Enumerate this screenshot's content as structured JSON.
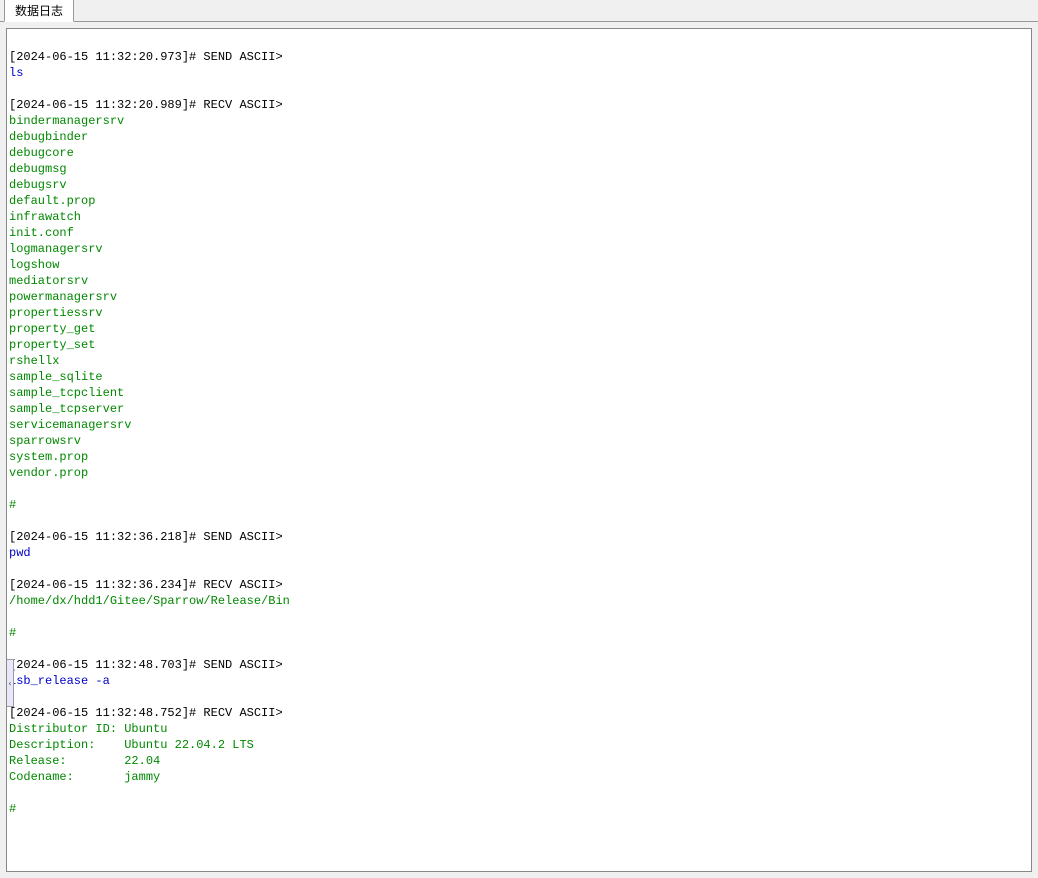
{
  "tab": {
    "label": "数据日志"
  },
  "handle": {
    "glyph": "‹"
  },
  "log": [
    {
      "type": "blank"
    },
    {
      "type": "header",
      "text": "[2024-06-15 11:32:20.973]# SEND ASCII>"
    },
    {
      "type": "cmd",
      "text": "ls"
    },
    {
      "type": "blank"
    },
    {
      "type": "header",
      "text": "[2024-06-15 11:32:20.989]# RECV ASCII>"
    },
    {
      "type": "recv",
      "text": "bindermanagersrv"
    },
    {
      "type": "recv",
      "text": "debugbinder"
    },
    {
      "type": "recv",
      "text": "debugcore"
    },
    {
      "type": "recv",
      "text": "debugmsg"
    },
    {
      "type": "recv",
      "text": "debugsrv"
    },
    {
      "type": "recv",
      "text": "default.prop"
    },
    {
      "type": "recv",
      "text": "infrawatch"
    },
    {
      "type": "recv",
      "text": "init.conf"
    },
    {
      "type": "recv",
      "text": "logmanagersrv"
    },
    {
      "type": "recv",
      "text": "logshow"
    },
    {
      "type": "recv",
      "text": "mediatorsrv"
    },
    {
      "type": "recv",
      "text": "powermanagersrv"
    },
    {
      "type": "recv",
      "text": "propertiessrv"
    },
    {
      "type": "recv",
      "text": "property_get"
    },
    {
      "type": "recv",
      "text": "property_set"
    },
    {
      "type": "recv",
      "text": "rshellx"
    },
    {
      "type": "recv",
      "text": "sample_sqlite"
    },
    {
      "type": "recv",
      "text": "sample_tcpclient"
    },
    {
      "type": "recv",
      "text": "sample_tcpserver"
    },
    {
      "type": "recv",
      "text": "servicemanagersrv"
    },
    {
      "type": "recv",
      "text": "sparrowsrv"
    },
    {
      "type": "recv",
      "text": "system.prop"
    },
    {
      "type": "recv",
      "text": "vendor.prop"
    },
    {
      "type": "blank"
    },
    {
      "type": "recv",
      "text": "# "
    },
    {
      "type": "blank"
    },
    {
      "type": "header",
      "text": "[2024-06-15 11:32:36.218]# SEND ASCII>"
    },
    {
      "type": "cmd",
      "text": "pwd"
    },
    {
      "type": "blank"
    },
    {
      "type": "header",
      "text": "[2024-06-15 11:32:36.234]# RECV ASCII>"
    },
    {
      "type": "recv",
      "text": "/home/dx/hdd1/Gitee/Sparrow/Release/Bin"
    },
    {
      "type": "blank"
    },
    {
      "type": "recv",
      "text": "# "
    },
    {
      "type": "blank"
    },
    {
      "type": "header",
      "text": "[2024-06-15 11:32:48.703]# SEND ASCII>"
    },
    {
      "type": "cmd",
      "text": "lsb_release -a"
    },
    {
      "type": "blank"
    },
    {
      "type": "header",
      "text": "[2024-06-15 11:32:48.752]# RECV ASCII>"
    },
    {
      "type": "recv",
      "text": "Distributor ID: Ubuntu"
    },
    {
      "type": "recv",
      "text": "Description:    Ubuntu 22.04.2 LTS"
    },
    {
      "type": "recv",
      "text": "Release:        22.04"
    },
    {
      "type": "recv",
      "text": "Codename:       jammy"
    },
    {
      "type": "blank"
    },
    {
      "type": "recv",
      "text": "# "
    }
  ]
}
